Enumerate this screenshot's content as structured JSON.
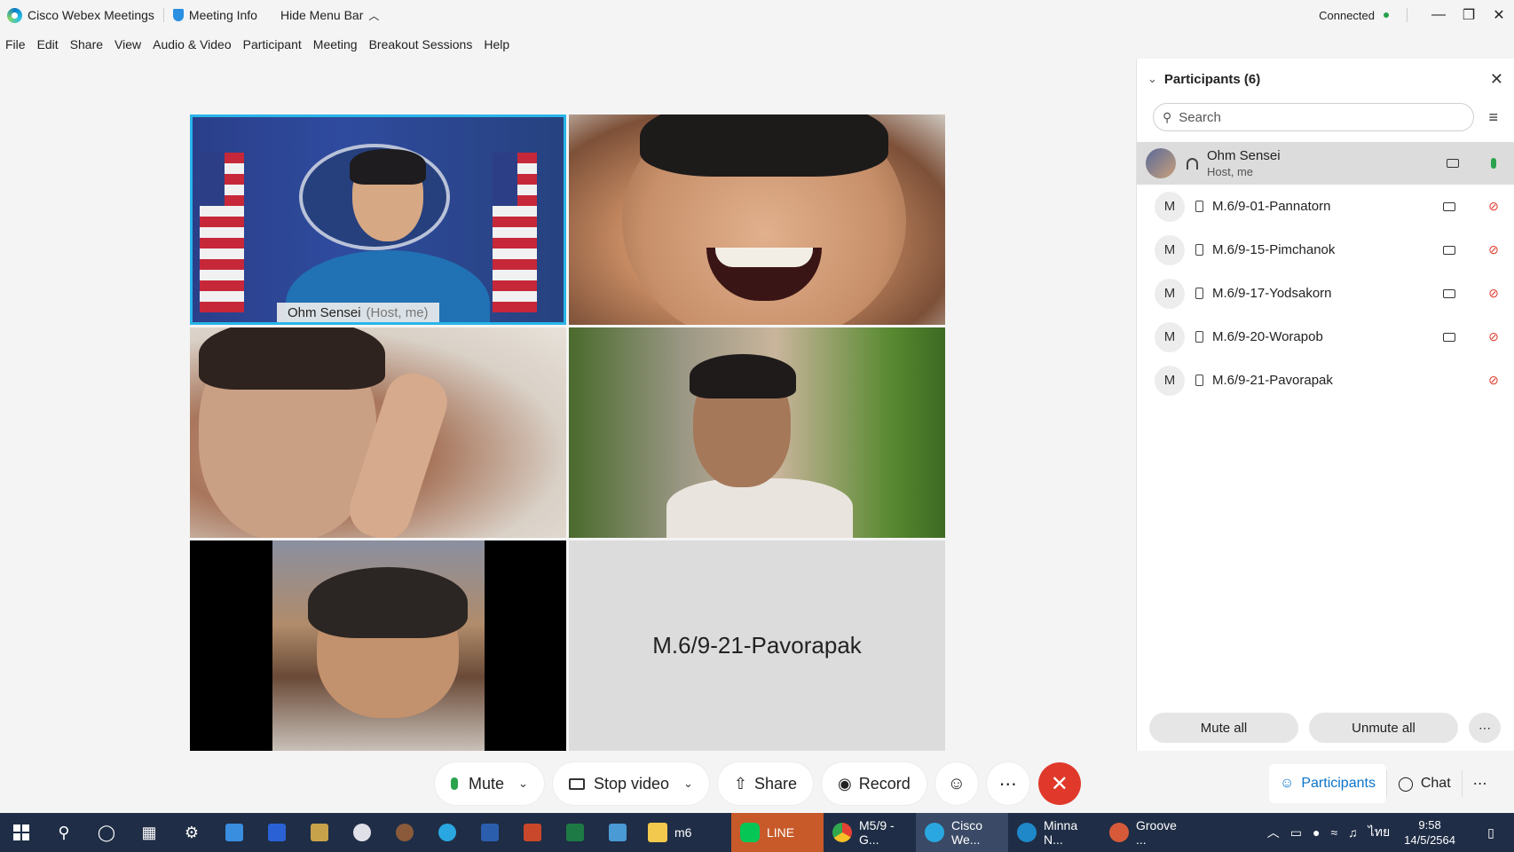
{
  "titlebar": {
    "app_title": "Cisco Webex Meetings",
    "meeting_info": "Meeting Info",
    "hide_menu": "Hide Menu Bar",
    "connection_status": "Connected"
  },
  "menu": [
    "File",
    "Edit",
    "Share",
    "View",
    "Audio & Video",
    "Participant",
    "Meeting",
    "Breakout Sessions",
    "Help"
  ],
  "video": {
    "host_name": "Ohm Sensei",
    "host_role": "(Host, me)",
    "no_video_name": "M.6/9-21-Pavorapak"
  },
  "toolbar": {
    "mute": "Mute",
    "stop_video": "Stop video",
    "share": "Share",
    "record": "Record"
  },
  "panel": {
    "title": "Participants (6)",
    "search_placeholder": "Search",
    "participants": [
      {
        "initial": "",
        "name": "Ohm Sensei",
        "role": "Host, me",
        "video": true,
        "muted": false
      },
      {
        "initial": "M",
        "name": "M.6/9-01-Pannatorn",
        "role": "",
        "video": true,
        "muted": true
      },
      {
        "initial": "M",
        "name": "M.6/9-15-Pimchanok",
        "role": "",
        "video": true,
        "muted": true
      },
      {
        "initial": "M",
        "name": "M.6/9-17-Yodsakorn",
        "role": "",
        "video": true,
        "muted": true
      },
      {
        "initial": "M",
        "name": "M.6/9-20-Worapob",
        "role": "",
        "video": true,
        "muted": true
      },
      {
        "initial": "M",
        "name": "M.6/9-21-Pavorapak",
        "role": "",
        "video": false,
        "muted": true
      }
    ],
    "mute_all": "Mute all",
    "unmute_all": "Unmute all"
  },
  "panel_tabs": {
    "participants": "Participants",
    "chat": "Chat"
  },
  "taskbar": {
    "apps": [
      {
        "label": "m6",
        "color": "#f2c94c"
      },
      {
        "label": "LINE",
        "color": "#06c755"
      },
      {
        "label": "M5/9 - G...",
        "color": "#e34133"
      },
      {
        "label": "Cisco We...",
        "color": "#2aa7e0"
      },
      {
        "label": "Minna N...",
        "color": "#1e88c9"
      },
      {
        "label": "Groove ...",
        "color": "#d65a3a"
      }
    ],
    "language": "ไทย",
    "time": "9:58",
    "date": "14/5/2564"
  },
  "colors": {
    "accent": "#0a74c9",
    "end_call": "#e0392b",
    "active_speaker": "#29b5e8",
    "taskbar": "#1f2d46"
  }
}
